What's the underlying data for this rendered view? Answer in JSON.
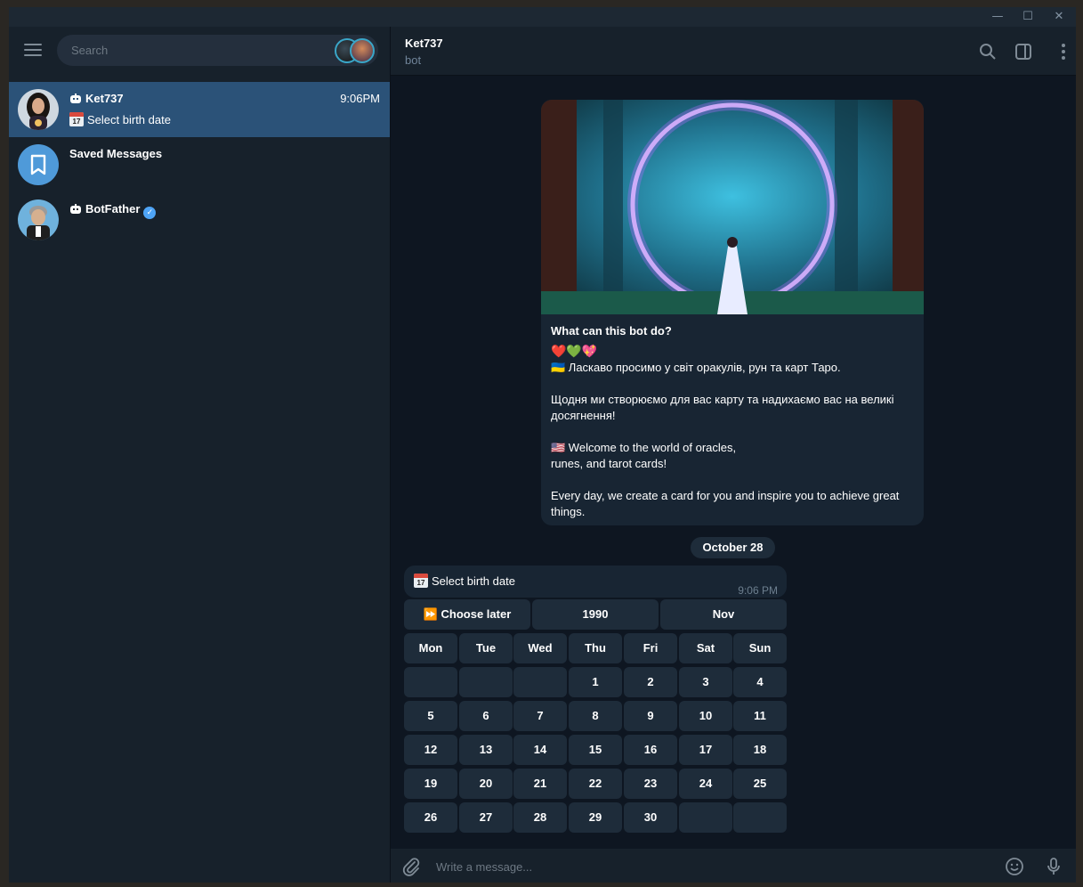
{
  "window": {
    "minimize": "—",
    "maximize": "☐",
    "close": "✕"
  },
  "sidebar": {
    "search_placeholder": "Search",
    "chats": [
      {
        "name": "Ket737",
        "time": "9:06PM",
        "preview": "Select birth date",
        "is_bot": true,
        "active": true
      },
      {
        "name": "Saved Messages",
        "time": "",
        "preview": "",
        "is_bot": false,
        "active": false
      },
      {
        "name": "BotFather",
        "time": "",
        "preview": "",
        "is_bot": true,
        "verified": true,
        "active": false
      }
    ]
  },
  "header": {
    "title": "Ket737",
    "subtitle": "bot"
  },
  "intro_card": {
    "title": "What can this bot do?",
    "emoji_line": "❤️💚💖",
    "paragraphs": [
      "🇺🇦 Ласкаво просимо у світ оракулів, рун та карт Таро.",
      "",
      "Щодня ми створюємо для вас карту та надихаємо вас на великі досягнення!",
      "",
      "🇺🇸 Welcome to the world of oracles,",
      "runes, and tarot cards!",
      "",
      "Every day, we create a card for you and inspire you to achieve great things."
    ]
  },
  "date_separator": "October 28",
  "bot_message": {
    "text": "Select birth date",
    "calendar_day": "17",
    "time": "9:06 PM"
  },
  "keyboard": {
    "top_row": [
      "⏩ Choose later",
      "1990",
      "Nov"
    ],
    "weekdays": [
      "Mon",
      "Tue",
      "Wed",
      "Thu",
      "Fri",
      "Sat",
      "Sun"
    ],
    "weeks": [
      [
        "",
        "",
        "",
        "1",
        "2",
        "3",
        "4"
      ],
      [
        "5",
        "6",
        "7",
        "8",
        "9",
        "10",
        "11"
      ],
      [
        "12",
        "13",
        "14",
        "15",
        "16",
        "17",
        "18"
      ],
      [
        "19",
        "20",
        "21",
        "22",
        "23",
        "24",
        "25"
      ],
      [
        "26",
        "27",
        "28",
        "29",
        "30",
        "",
        ""
      ]
    ]
  },
  "composer": {
    "placeholder": "Write a message..."
  },
  "colors": {
    "accent": "#2b5278",
    "bubble": "#182533",
    "button": "#1e2c3a",
    "verified": "#4ea4f6"
  }
}
